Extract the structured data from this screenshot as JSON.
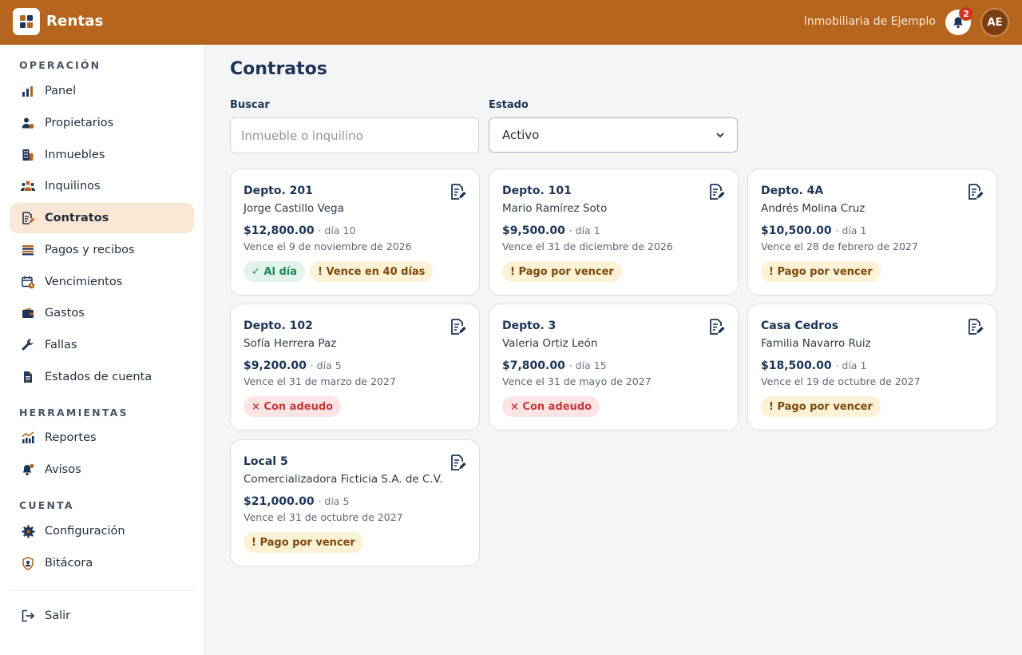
{
  "app": {
    "brand": "Rentas",
    "organization": "Inmobiliaria de Ejemplo",
    "notifications_count": "2",
    "user_initials": "AE"
  },
  "colors": {
    "topbar": "#b5651d",
    "active_nav": "#fbe7d6",
    "ok": "#1c8a55",
    "warn": "#7a4a0c",
    "bad": "#c23a3a"
  },
  "sidebar": {
    "sections": [
      {
        "title": "OPERACIÓN"
      },
      {
        "title": "HERRAMIENTAS"
      },
      {
        "title": "CUENTA"
      }
    ],
    "items": [
      {
        "label": "Panel",
        "icon": "bar-chart-icon"
      },
      {
        "label": "Propietarios",
        "icon": "owner-icon"
      },
      {
        "label": "Inmuebles",
        "icon": "building-icon"
      },
      {
        "label": "Inquilinos",
        "icon": "people-icon"
      },
      {
        "label": "Contratos",
        "icon": "contract-icon",
        "active": true
      },
      {
        "label": "Pagos y recibos",
        "icon": "cash-stack-icon"
      },
      {
        "label": "Vencimientos",
        "icon": "calendar-icon"
      },
      {
        "label": "Gastos",
        "icon": "wallet-icon"
      },
      {
        "label": "Fallas",
        "icon": "wrench-icon"
      },
      {
        "label": "Estados de cuenta",
        "icon": "statement-icon"
      },
      {
        "label": "Reportes",
        "icon": "trend-chart-icon"
      },
      {
        "label": "Avisos",
        "icon": "bell-icon"
      },
      {
        "label": "Configuración",
        "icon": "gear-icon"
      },
      {
        "label": "Bitácora",
        "icon": "shield-user-icon"
      },
      {
        "label": "Salir",
        "icon": "logout-icon"
      }
    ]
  },
  "main": {
    "title": "Contratos",
    "search": {
      "label": "Buscar",
      "placeholder": "Inmueble o inquilino",
      "value": ""
    },
    "status": {
      "label": "Estado",
      "selected": "Activo"
    },
    "cards": [
      {
        "title": "Depto. 201",
        "tenant": "Jorge Castillo Vega",
        "amount": "$12,800.00",
        "day": "· día 10",
        "due": "Vence el 9 de noviembre de 2026",
        "badges": [
          {
            "text": "✓ Al día",
            "kind": "ok"
          },
          {
            "text": "! Vence en 40 días",
            "kind": "warn"
          }
        ]
      },
      {
        "title": "Depto. 101",
        "tenant": "Mario Ramírez Soto",
        "amount": "$9,500.00",
        "day": "· día 1",
        "due": "Vence el 31 de diciembre de 2026",
        "badges": [
          {
            "text": "! Pago por vencer",
            "kind": "warn"
          }
        ]
      },
      {
        "title": "Depto. 4A",
        "tenant": "Andrés Molina Cruz",
        "amount": "$10,500.00",
        "day": "· día 1",
        "due": "Vence el 28 de febrero de 2027",
        "badges": [
          {
            "text": "! Pago por vencer",
            "kind": "warn"
          }
        ]
      },
      {
        "title": "Depto. 102",
        "tenant": "Sofía Herrera Paz",
        "amount": "$9,200.00",
        "day": "· día 5",
        "due": "Vence el 31 de marzo de 2027",
        "badges": [
          {
            "text": "× Con adeudo",
            "kind": "bad"
          }
        ]
      },
      {
        "title": "Depto. 3",
        "tenant": "Valeria Ortiz León",
        "amount": "$7,800.00",
        "day": "· día 15",
        "due": "Vence el 31 de mayo de 2027",
        "badges": [
          {
            "text": "× Con adeudo",
            "kind": "bad"
          }
        ]
      },
      {
        "title": "Casa Cedros",
        "tenant": "Familia Navarro Ruiz",
        "amount": "$18,500.00",
        "day": "· día 1",
        "due": "Vence el 19 de octubre de 2027",
        "badges": [
          {
            "text": "! Pago por vencer",
            "kind": "warn"
          }
        ]
      },
      {
        "title": "Local 5",
        "tenant": "Comercializadora Ficticia S.A. de C.V.",
        "amount": "$21,000.00",
        "day": "· día 5",
        "due": "Vence el 31 de octubre de 2027",
        "badges": [
          {
            "text": "! Pago por vencer",
            "kind": "warn"
          }
        ]
      }
    ]
  }
}
